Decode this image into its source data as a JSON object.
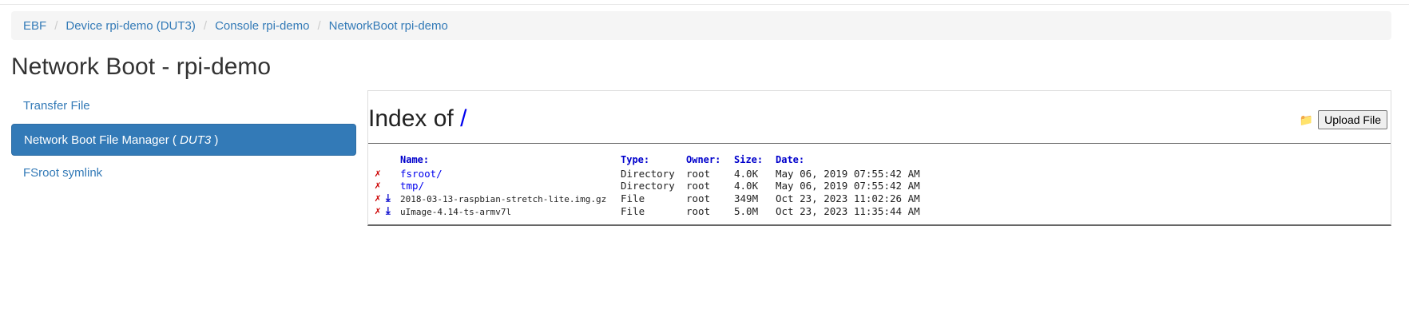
{
  "breadcrumb": [
    "EBF",
    "Device rpi-demo (DUT3)",
    "Console rpi-demo",
    "NetworkBoot rpi-demo"
  ],
  "page_title": "Network Boot - rpi-demo",
  "sidenav": {
    "transfer_file": "Transfer File",
    "manager_label": "Network Boot File Manager ( ",
    "manager_device": "DUT3",
    "manager_close": " )",
    "fsroot_symlink": "FSroot symlink"
  },
  "index": {
    "title_prefix": "Index of ",
    "path": "/",
    "upload_label": "Upload File"
  },
  "table": {
    "headers": {
      "name": "Name:",
      "type": "Type:",
      "owner": "Owner:",
      "size": "Size:",
      "date": "Date:"
    },
    "rows": [
      {
        "delete": "✗",
        "name": "fsroot/",
        "type": "Directory",
        "owner": "root",
        "size": "4.0K",
        "date": "May 06, 2019 07:55:42 AM"
      },
      {
        "delete": "✗",
        "name": "tmp/",
        "type": "Directory",
        "owner": "root",
        "size": "4.0K",
        "date": "May 06, 2019 07:55:42 AM"
      },
      {
        "delete": "✗",
        "name": "2018-03-13-raspbian-stretch-lite.img.gz",
        "type": "File",
        "owner": "root",
        "size": "349M",
        "date": "Oct 23, 2023 11:02:26 AM"
      },
      {
        "delete": "✗",
        "name": "uImage-4.14-ts-armv7l",
        "type": "File",
        "owner": "root",
        "size": "5.0M",
        "date": "Oct 23, 2023 11:35:44 AM"
      }
    ]
  },
  "colors": {
    "link": "#337ab7",
    "active_bg": "#337ab7",
    "delete": "#cc0000",
    "header_blue": "#0000cc"
  }
}
